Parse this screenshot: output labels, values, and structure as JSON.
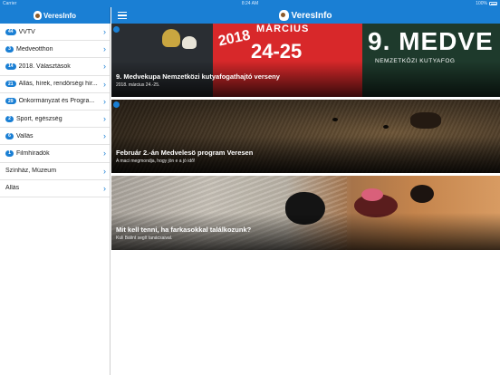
{
  "status_bar": {
    "carrier": "Carrier",
    "time": "8:24 AM",
    "battery": "100%"
  },
  "app": {
    "name": "VeresInfo"
  },
  "sidebar": {
    "items": [
      {
        "badge": "44",
        "label": "VVTV"
      },
      {
        "badge": "3",
        "label": "Medveotthon"
      },
      {
        "badge": "14",
        "label": "2018. Választások"
      },
      {
        "badge": "21",
        "label": "Állás, hírek, rendőrségi hír..."
      },
      {
        "badge": "29",
        "label": "Önkormányzat és Progra..."
      },
      {
        "badge": "2",
        "label": "Sport, egészség"
      },
      {
        "badge": "6",
        "label": "Vallás"
      },
      {
        "badge": "1",
        "label": "Filmhíradók"
      },
      {
        "badge": "",
        "label": "Színház, Múzeum"
      },
      {
        "badge": "",
        "label": "Állás"
      }
    ]
  },
  "feed": {
    "cards": [
      {
        "title": "9. Medvekupa Nemzetközi kutyafogathajtó verseny",
        "subtitle": "2018. március 24.-25.",
        "poster": {
          "year": "2018",
          "month": "MÁRCIUS",
          "dates": "24-25",
          "big": "9. MEDVE",
          "small": "NEMZETKÖZI KUTYAFOG"
        }
      },
      {
        "title": "Február 2.-án Medvelesö program Veresen",
        "subtitle": "A maci megmondja, hogy jön e a jó idő!"
      },
      {
        "title": "Mit kell tenni, ha farkasokkal találkozunk?",
        "subtitle": "Kuli Bálint segít tanácsaival."
      }
    ]
  },
  "colors": {
    "accent": "#1a7fd4"
  }
}
